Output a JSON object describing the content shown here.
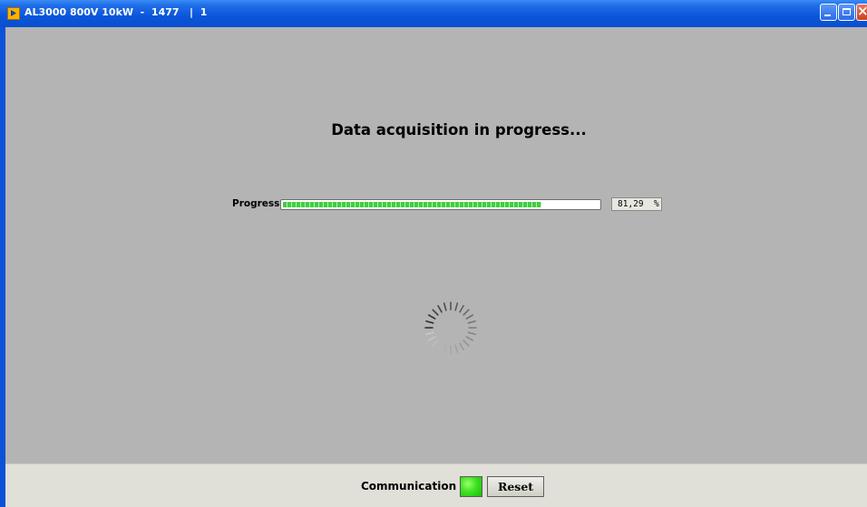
{
  "window": {
    "title": "AL3000 800V 10kW  -  1477   |  1",
    "icon": "labview-app-icon"
  },
  "main": {
    "heading": "Data acquisition in progress...",
    "progress": {
      "label": "Progress",
      "value_text": "81,29  %",
      "fraction": 0.8129,
      "fill_color": "#3fcf3f"
    },
    "spinner": {
      "icon": "busy-spinner-icon"
    }
  },
  "footer": {
    "communication_label": "Communication",
    "communication_led_color": "#3ee321",
    "reset_label": "Reset"
  }
}
